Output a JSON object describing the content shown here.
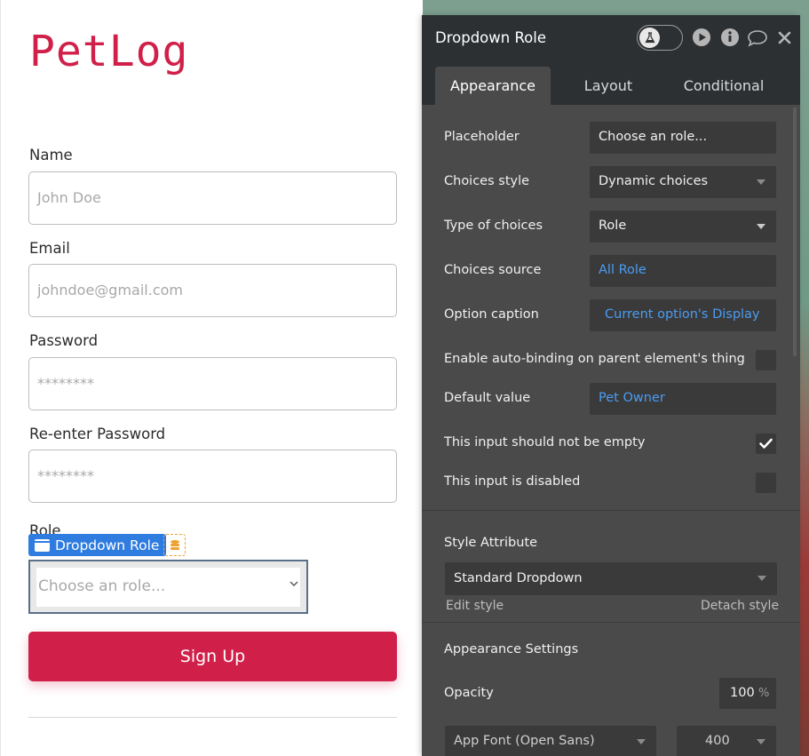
{
  "app": {
    "logo": "PetLog",
    "fields": [
      {
        "label": "Name",
        "placeholder": "John Doe"
      },
      {
        "label": "Email",
        "placeholder": "johndoe@gmail.com"
      },
      {
        "label": "Password",
        "placeholder": "********"
      },
      {
        "label": "Re-enter Password",
        "placeholder": "********"
      }
    ],
    "role_label": "Role",
    "element_tag": "Dropdown Role",
    "dropdown_placeholder": "Choose an role...",
    "signup_button": "Sign Up"
  },
  "panel": {
    "title": "Dropdown Role",
    "tabs": [
      "Appearance",
      "Layout",
      "Conditional"
    ],
    "active_tab": "Appearance",
    "properties": {
      "placeholder": {
        "label": "Placeholder",
        "value": "Choose an role..."
      },
      "choices_style": {
        "label": "Choices style",
        "value": "Dynamic choices"
      },
      "type_of_choices": {
        "label": "Type of choices",
        "value": "Role"
      },
      "choices_source": {
        "label": "Choices source",
        "value": "All Role"
      },
      "option_caption": {
        "label": "Option caption",
        "value": "Current option's Display"
      },
      "auto_binding": {
        "label": "Enable auto-binding on parent element's thing",
        "checked": false
      },
      "default_value": {
        "label": "Default value",
        "value": "Pet Owner"
      },
      "not_empty": {
        "label": "This input should not be empty",
        "checked": true
      },
      "disabled": {
        "label": "This input is disabled",
        "checked": false
      }
    },
    "style_attribute": {
      "heading": "Style Attribute",
      "value": "Standard Dropdown",
      "edit_link": "Edit style",
      "detach_link": "Detach style"
    },
    "appearance_settings": {
      "heading": "Appearance Settings",
      "opacity_label": "Opacity",
      "opacity_value": "100",
      "opacity_unit": "%",
      "font_value": "App Font (Open Sans)",
      "weight_value": "400"
    }
  },
  "colors": {
    "brand": "#d0204a",
    "selection_blue": "#2f7ce0",
    "panel_bg": "#4a4a4a",
    "panel_header": "#2d3033",
    "link_blue": "#4a9cf2"
  }
}
